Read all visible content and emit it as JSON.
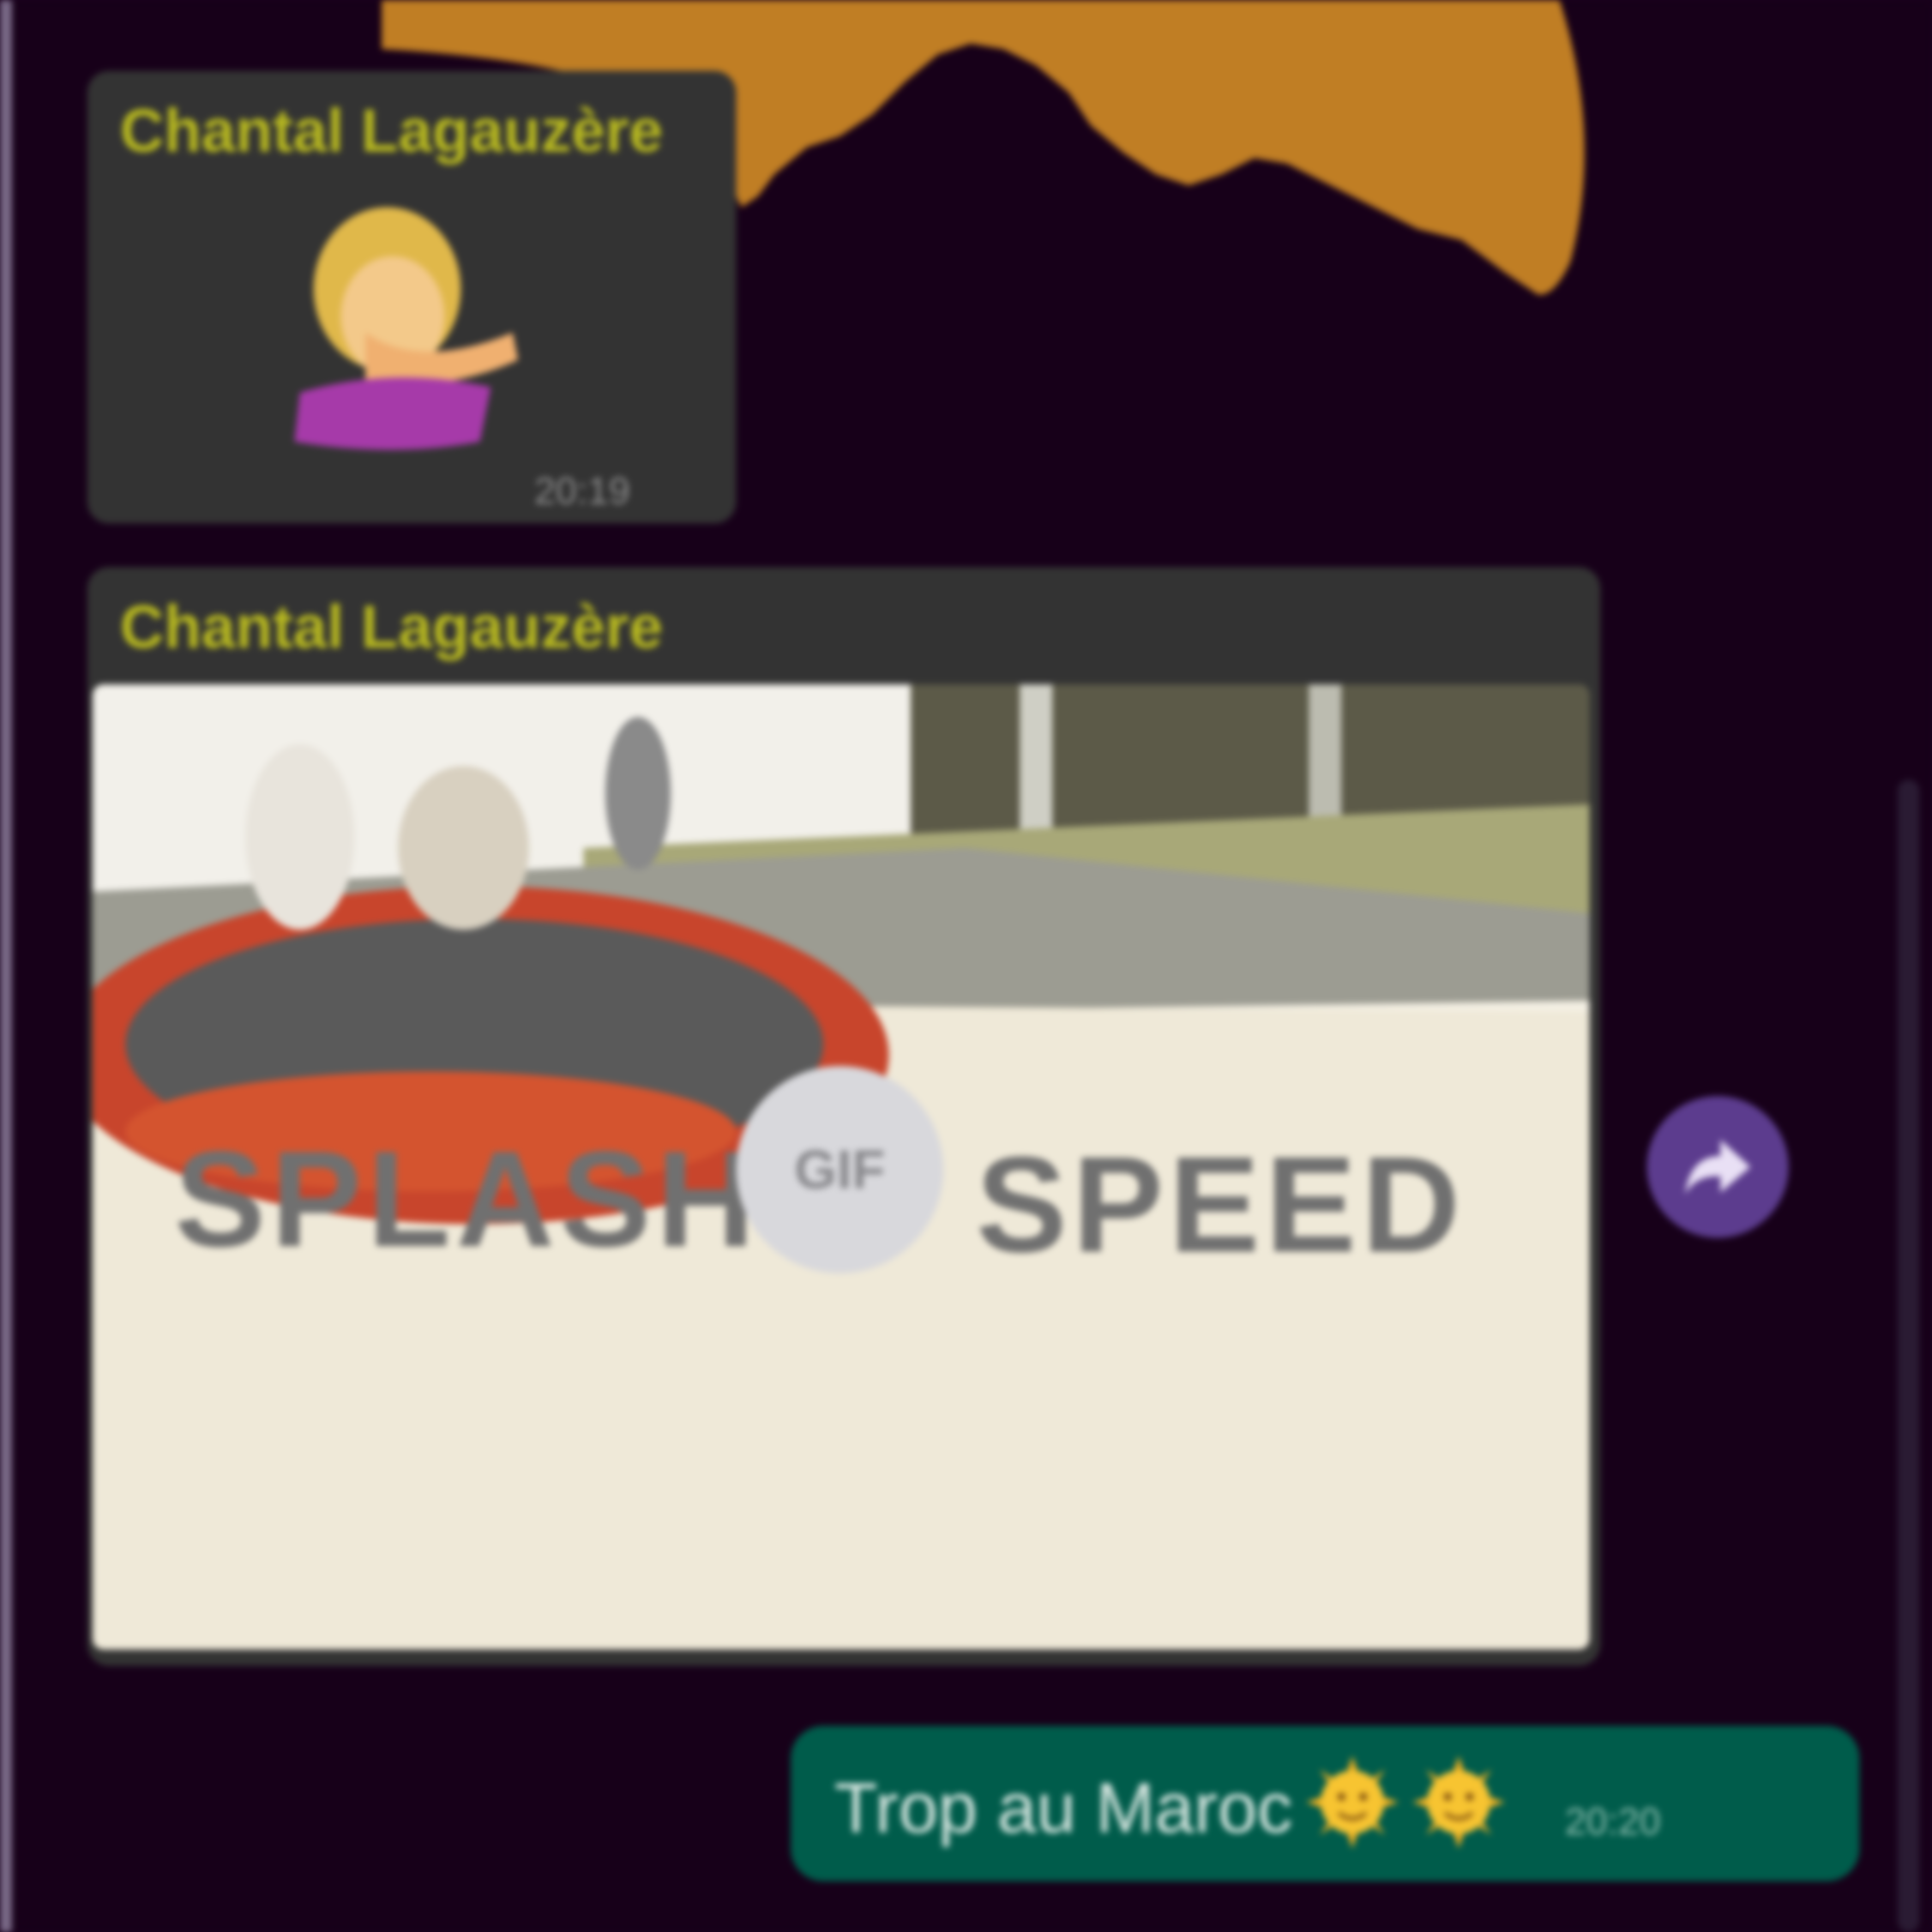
{
  "chat": {
    "messages": [
      {
        "sender": "Chantal Lagauzère",
        "type": "sticker",
        "time": "20:19"
      },
      {
        "sender": "Chantal Lagauzère",
        "type": "gif",
        "badge": "GIF",
        "watermark_left": "SPLASH",
        "watermark_right": "SPEED"
      },
      {
        "type": "outgoing",
        "text": "Trop au Maroc",
        "emoji": [
          "sun-face",
          "sun-face"
        ],
        "time": "20:20"
      }
    ]
  },
  "colors": {
    "background": "#170019",
    "incoming_bubble": "#333333",
    "outgoing_bubble": "#005c4b",
    "sender_name": "#b7b820",
    "forward_button": "#5c3c8e",
    "wallpaper_accent": "#c07e24"
  },
  "icons": {
    "forward": "forward-arrow-icon"
  }
}
